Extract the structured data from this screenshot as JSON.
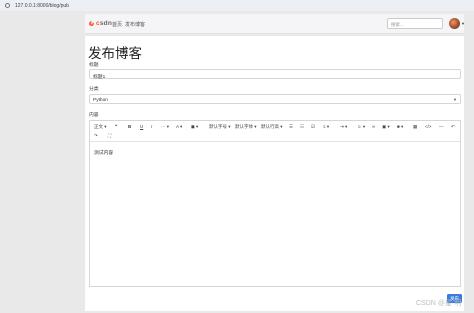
{
  "browser": {
    "url": "127.0.0.1:8000/blog/pub"
  },
  "navbar": {
    "brand_prefix": "c",
    "brand_text": "sdn",
    "links": [
      "首页",
      "发布博客"
    ],
    "search_placeholder": "搜索..."
  },
  "page": {
    "title": "发布博客",
    "title_label": "标题",
    "title_value": "标题1",
    "category_label": "分类",
    "category_value": "Python",
    "content_label": "内容",
    "content_value": "测试内容",
    "submit_label": "发布"
  },
  "toolbar": {
    "paragraph": "正文",
    "font_size": "默认字号",
    "font_family": "默认字体",
    "line_height": "默认行高"
  },
  "watermark": "CSDN @星·明"
}
